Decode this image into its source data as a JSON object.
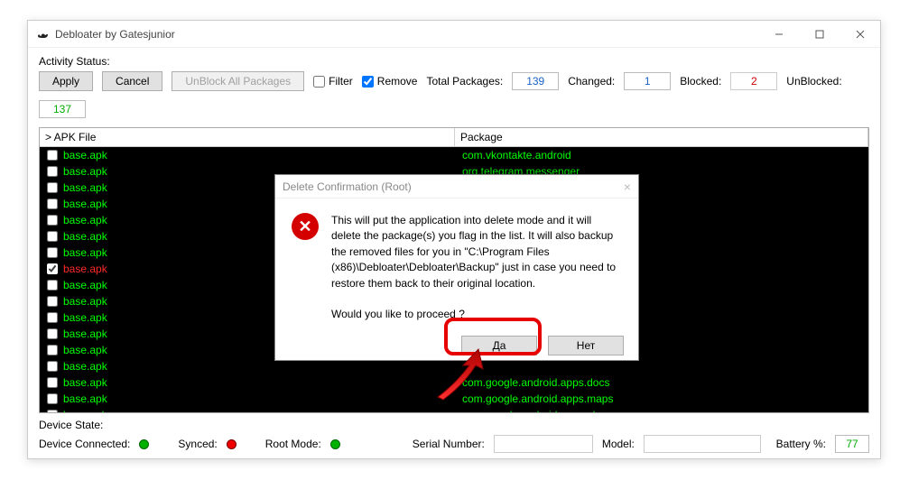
{
  "window": {
    "title": "Debloater by Gatesjunior"
  },
  "toolbar": {
    "activity_label": "Activity Status:",
    "apply": "Apply",
    "cancel": "Cancel",
    "unblock_all": "UnBlock All Packages",
    "filter_label": "Filter",
    "remove_label": "Remove",
    "filter_checked": false,
    "remove_checked": true,
    "total_label": "Total Packages:",
    "total_value": "139",
    "changed_label": "Changed:",
    "changed_value": "1",
    "blocked_label": "Blocked:",
    "blocked_value": "2",
    "unblocked_label": "UnBlocked:",
    "unblocked_value": "137"
  },
  "table": {
    "col1": "> APK File",
    "col2": "Package",
    "rows": [
      {
        "apk": "base.apk",
        "pkg": "com.vkontakte.android",
        "checked": false,
        "red": false
      },
      {
        "apk": "base.apk",
        "pkg": "org.telegram.messenger",
        "checked": false,
        "red": false
      },
      {
        "apk": "base.apk",
        "pkg": "",
        "checked": false,
        "red": false
      },
      {
        "apk": "base.apk",
        "pkg": "",
        "checked": false,
        "red": false
      },
      {
        "apk": "base.apk",
        "pkg": "",
        "checked": false,
        "red": false
      },
      {
        "apk": "base.apk",
        "pkg": "",
        "checked": false,
        "red": false
      },
      {
        "apk": "base.apk",
        "pkg": "",
        "checked": false,
        "red": false
      },
      {
        "apk": "base.apk",
        "pkg": "",
        "checked": true,
        "red": true
      },
      {
        "apk": "base.apk",
        "pkg": "",
        "checked": false,
        "red": false
      },
      {
        "apk": "base.apk",
        "pkg": "",
        "checked": false,
        "red": false
      },
      {
        "apk": "base.apk",
        "pkg": "",
        "checked": false,
        "red": false
      },
      {
        "apk": "base.apk",
        "pkg": "",
        "checked": false,
        "red": false
      },
      {
        "apk": "base.apk",
        "pkg": "",
        "checked": false,
        "red": false
      },
      {
        "apk": "base.apk",
        "pkg": "",
        "checked": false,
        "red": false
      },
      {
        "apk": "base.apk",
        "pkg": "com.google.android.apps.docs",
        "checked": false,
        "red": false
      },
      {
        "apk": "base.apk",
        "pkg": "com.google.android.apps.maps",
        "checked": false,
        "red": false
      },
      {
        "apk": "base.apk",
        "pkg": "com.google.android.apps.plus",
        "checked": false,
        "red": false
      }
    ]
  },
  "status": {
    "device_state_label": "Device State:",
    "device_connected_label": "Device Connected:",
    "synced_label": "Synced:",
    "root_label": "Root Mode:",
    "serial_label": "Serial Number:",
    "model_label": "Model:",
    "battery_label": "Battery %:",
    "battery_value": "77"
  },
  "dialog": {
    "title": "Delete Confirmation (Root)",
    "body": "This will put the application into delete mode and it will delete the package(s) you flag in the list.  It will also  backup the removed files for you in \"C:\\Program Files (x86)\\Debloater\\Debloater\\Backup\" just in case you need to restore them back to their original location.",
    "question": "Would you like to proceed ?",
    "yes": "Да",
    "no": "Нет"
  }
}
